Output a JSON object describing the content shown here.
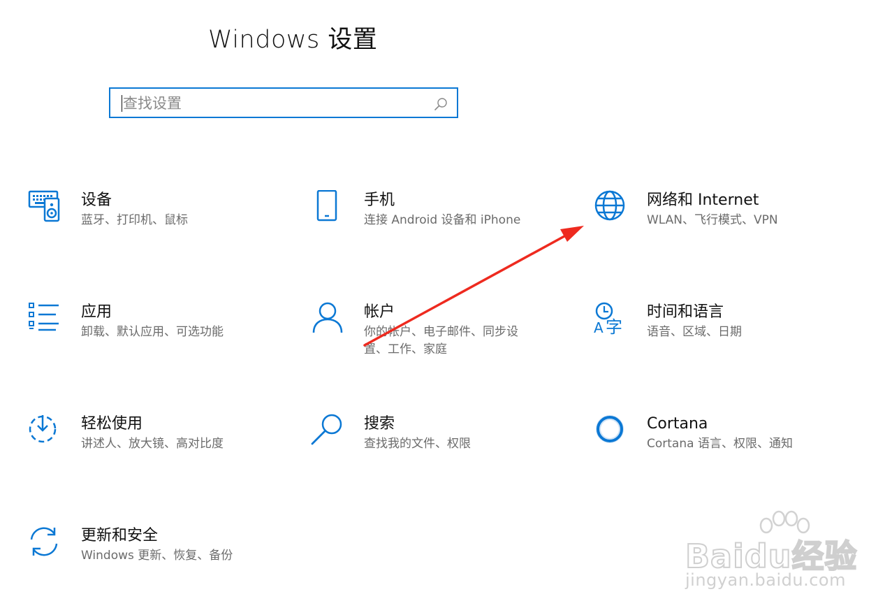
{
  "header": {
    "title": "Windows 设置"
  },
  "search": {
    "placeholder": "查找设置",
    "value": ""
  },
  "tiles": [
    {
      "title": "设备",
      "desc": "蓝牙、打印机、鼠标",
      "icon": "devices-icon"
    },
    {
      "title": "手机",
      "desc": "连接 Android 设备和 iPhone",
      "icon": "phone-icon"
    },
    {
      "title": "网络和 Internet",
      "desc": "WLAN、飞行模式、VPN",
      "icon": "globe-icon"
    },
    {
      "title": "应用",
      "desc": "卸载、默认应用、可选功能",
      "icon": "apps-list-icon"
    },
    {
      "title": "帐户",
      "desc": "你的帐户、电子邮件、同步设置、工作、家庭",
      "icon": "person-icon"
    },
    {
      "title": "时间和语言",
      "desc": "语音、区域、日期",
      "icon": "time-language-icon"
    },
    {
      "title": "轻松使用",
      "desc": "讲述人、放大镜、高对比度",
      "icon": "ease-of-access-icon"
    },
    {
      "title": "搜索",
      "desc": "查找我的文件、权限",
      "icon": "search-magnifier-icon"
    },
    {
      "title": "Cortana",
      "desc": "Cortana 语言、权限、通知",
      "icon": "cortana-ring-icon"
    },
    {
      "title": "更新和安全",
      "desc": "Windows 更新、恢复、备份",
      "icon": "update-sync-icon"
    }
  ],
  "watermark": {
    "brand": "Baidu经验",
    "url": "jingyan.baidu.com"
  },
  "colors": {
    "accent": "#0b78d4",
    "arrow": "#ee2a1f"
  }
}
